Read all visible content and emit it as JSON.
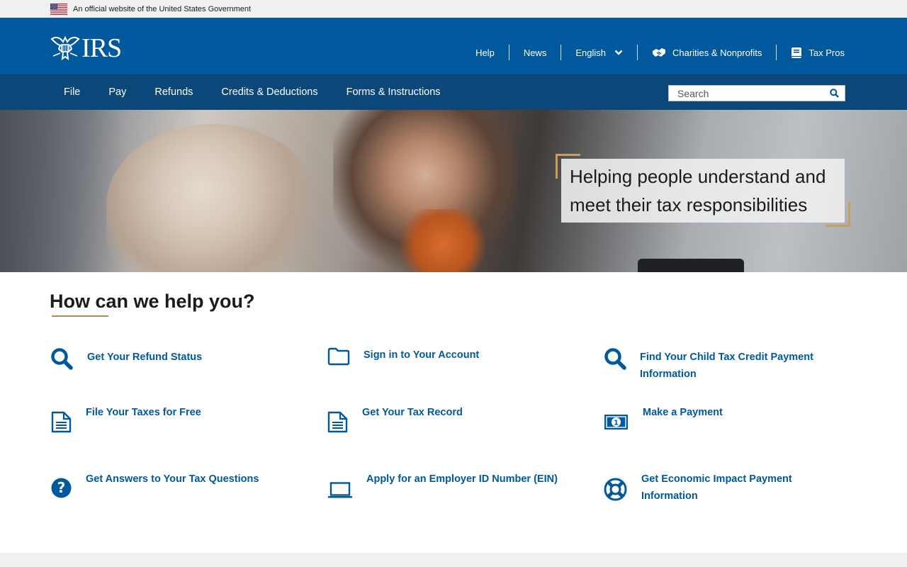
{
  "gov_banner": {
    "text": "An official website of the United States Government"
  },
  "header": {
    "logo_text": "IRS",
    "utility_nav": [
      {
        "label": "Help"
      },
      {
        "label": "News"
      },
      {
        "label": "English",
        "icon": "chevron-down-icon"
      },
      {
        "label": "Charities & Nonprofits",
        "icon": "handshake-icon"
      },
      {
        "label": "Tax Pros",
        "icon": "book-icon"
      }
    ]
  },
  "main_nav": {
    "items": [
      {
        "label": "File"
      },
      {
        "label": "Pay"
      },
      {
        "label": "Refunds"
      },
      {
        "label": "Credits & Deductions"
      },
      {
        "label": "Forms & Instructions"
      }
    ],
    "search": {
      "placeholder": "Search"
    }
  },
  "hero": {
    "headline": "Helping people understand and meet their tax responsibilities"
  },
  "help": {
    "title": "How can we help you?",
    "tiles": [
      {
        "label": "Get Your Refund Status",
        "icon": "search-icon"
      },
      {
        "label": "Sign in to Your Account",
        "icon": "folder-icon"
      },
      {
        "label": "Find Your Child Tax Credit Payment Information",
        "icon": "search-icon"
      },
      {
        "label": "File Your Taxes for Free",
        "icon": "document-icon"
      },
      {
        "label": "Get Your Tax Record",
        "icon": "document-icon"
      },
      {
        "label": "Make a Payment",
        "icon": "money-icon"
      },
      {
        "label": "Get Answers to Your Tax Questions",
        "icon": "question-icon"
      },
      {
        "label": "Apply for an Employer ID Number (EIN)",
        "icon": "laptop-icon"
      },
      {
        "label": "Get Economic Impact Payment Information",
        "icon": "life-ring-icon"
      }
    ]
  },
  "colors": {
    "header_blue": "#00599c",
    "nav_blue": "#0b4779",
    "link_blue": "#00599c",
    "accent_gold": "#c69f5e"
  }
}
